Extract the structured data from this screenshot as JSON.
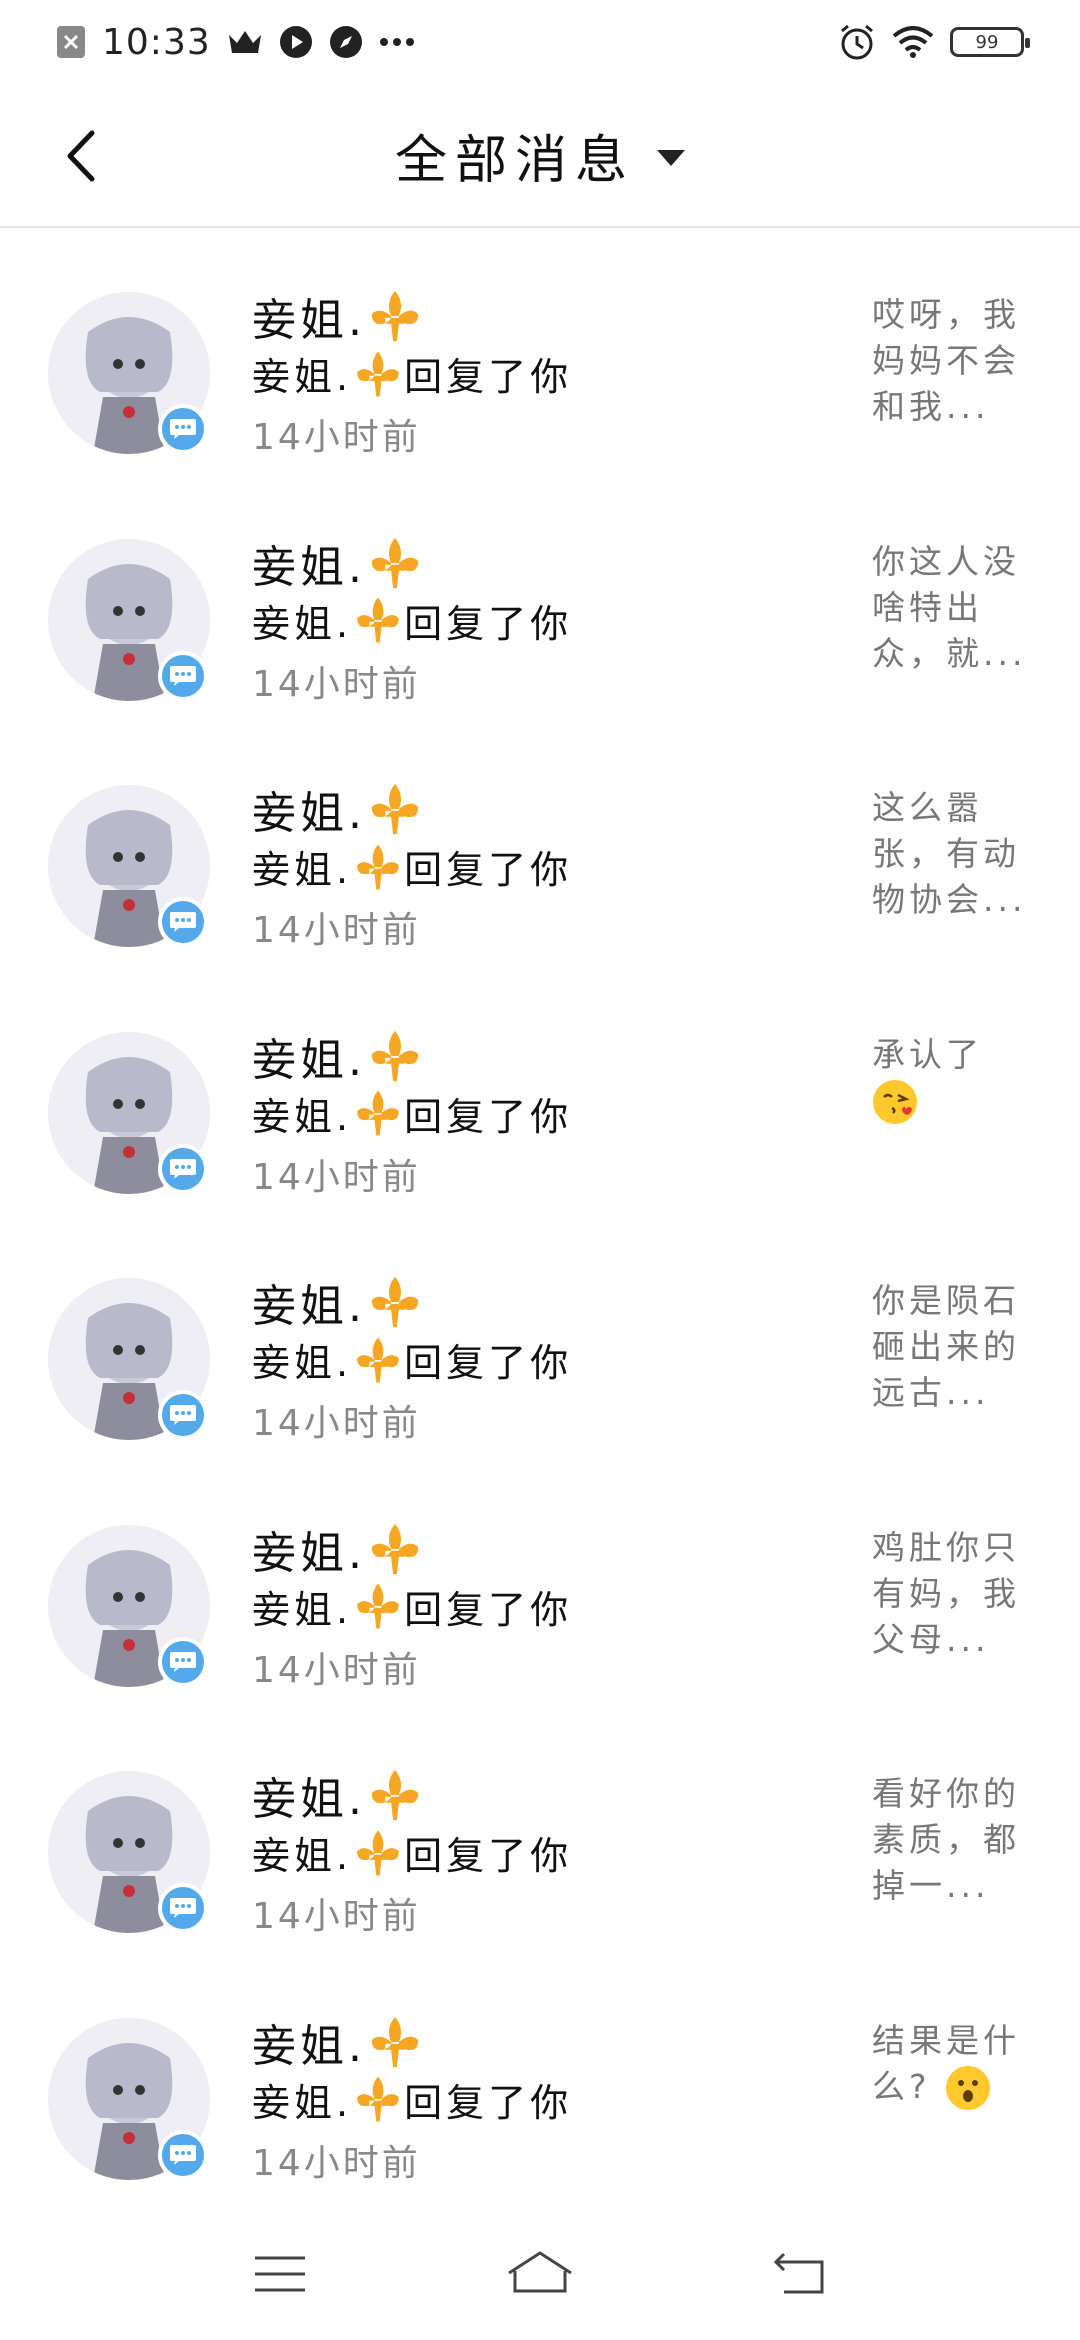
{
  "status_bar": {
    "time": "10:33",
    "battery": "99",
    "left_icons": [
      "close-box-icon",
      "crown-icon",
      "play-circle-icon",
      "compass-icon",
      "more-dots-icon"
    ],
    "right_icons": [
      "alarm-icon",
      "wifi-icon",
      "battery-icon"
    ]
  },
  "header": {
    "title": "全部消息",
    "back_icon": "chevron-left-icon",
    "dropdown_icon": "triangle-down-icon"
  },
  "messages": [
    {
      "name": "妾姐.",
      "action_prefix": "妾姐.",
      "action": "回复了你",
      "time": "14小时前",
      "preview": "哎呀，我妈妈不会和我..."
    },
    {
      "name": "妾姐.",
      "action_prefix": "妾姐.",
      "action": "回复了你",
      "time": "14小时前",
      "preview": "你这人没啥特出众，就..."
    },
    {
      "name": "妾姐.",
      "action_prefix": "妾姐.",
      "action": "回复了你",
      "time": "14小时前",
      "preview": "这么嚣张，有动物协会..."
    },
    {
      "name": "妾姐.",
      "action_prefix": "妾姐.",
      "action": "回复了你",
      "time": "14小时前",
      "preview": "承认了"
    },
    {
      "name": "妾姐.",
      "action_prefix": "妾姐.",
      "action": "回复了你",
      "time": "14小时前",
      "preview": "你是陨石砸出来的远古..."
    },
    {
      "name": "妾姐.",
      "action_prefix": "妾姐.",
      "action": "回复了你",
      "time": "14小时前",
      "preview": "鸡肚你只有妈，我父母..."
    },
    {
      "name": "妾姐.",
      "action_prefix": "妾姐.",
      "action": "回复了你",
      "time": "14小时前",
      "preview": "看好你的素质，都掉一..."
    },
    {
      "name": "妾姐.",
      "action_prefix": "妾姐.",
      "action": "回复了你",
      "time": "14小时前",
      "preview": "结果是什么?"
    }
  ],
  "preview_emojis": {
    "3": "kissing-face-icon",
    "7": "surprised-face-icon"
  },
  "bottom_nav": [
    "menu-icon",
    "home-icon",
    "back-icon"
  ],
  "colors": {
    "badge": "#53a9ea",
    "fleur": "#f5a623",
    "emoji": "#ffc82c"
  }
}
